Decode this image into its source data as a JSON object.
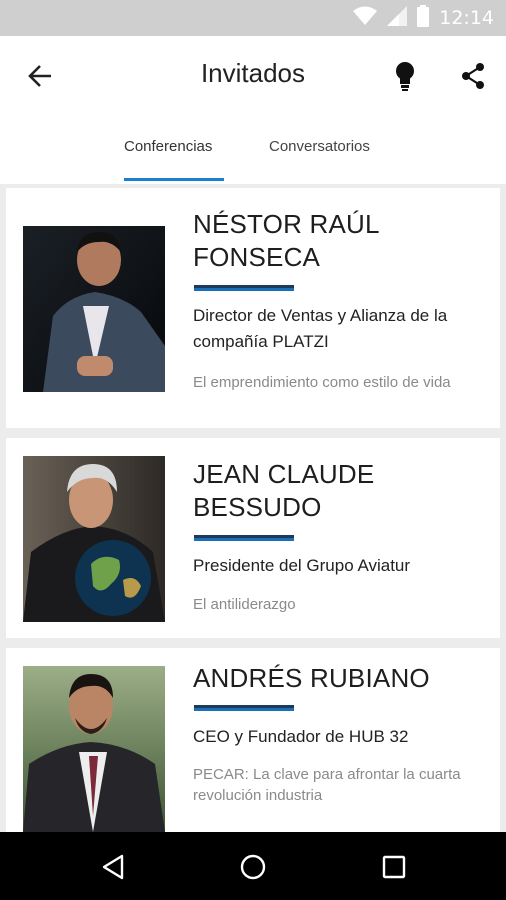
{
  "status_bar": {
    "time": "12:14",
    "icons": [
      "wifi-icon",
      "signal-icon",
      "battery-icon"
    ]
  },
  "app_bar": {
    "title": "Invitados",
    "icons": [
      "back-arrow-icon",
      "lightbulb-icon",
      "share-icon"
    ]
  },
  "tabs": [
    {
      "label": "Conferencias",
      "active": true
    },
    {
      "label": "Conversatorios",
      "active": false
    }
  ],
  "speakers": [
    {
      "name": "NÉSTOR RAÚL FONSECA",
      "role": "Director de Ventas y Alianza de la compañía PLATZI",
      "talk": "El emprendimiento como estilo de vida"
    },
    {
      "name": "JEAN CLAUDE BESSUDO",
      "role": "Presidente del Grupo Aviatur",
      "talk": "El antiliderazgo"
    },
    {
      "name": "ANDRÉS RUBIANO",
      "role": "CEO y Fundador de HUB 32",
      "talk": "PECAR: La clave para afrontar la cuarta revolución industria"
    }
  ],
  "colors": {
    "accent": "#1f7ec9",
    "divider_dark": "#1b3a5c",
    "status_bar": "#cfcfcf"
  },
  "nav_bar": {
    "icons": [
      "back-triangle-icon",
      "home-circle-icon",
      "recents-square-icon"
    ]
  }
}
